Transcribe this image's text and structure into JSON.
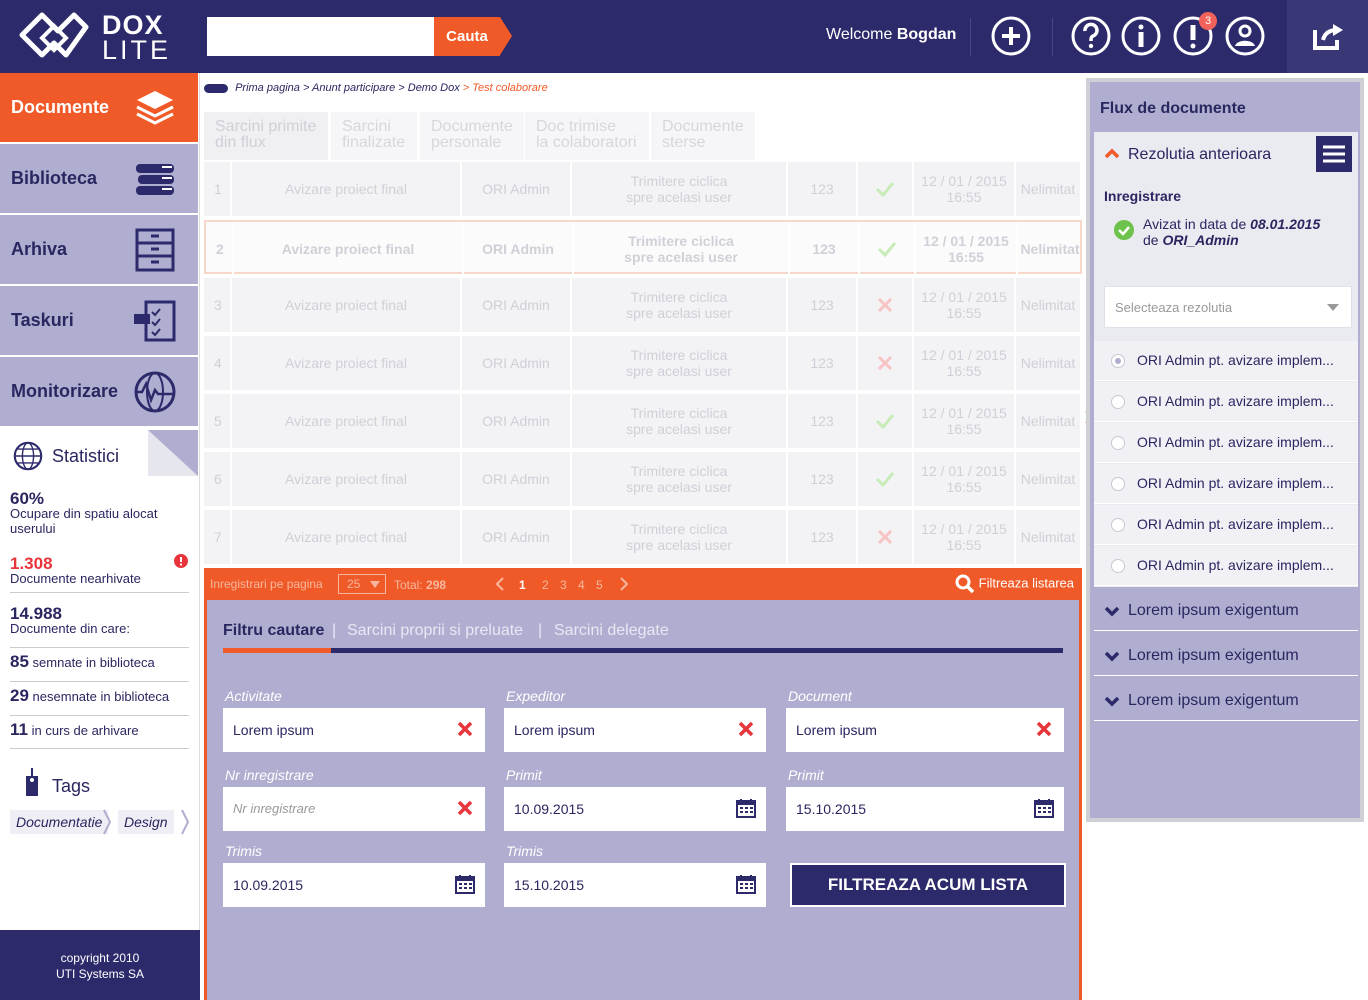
{
  "header": {
    "logo_top": "DOX",
    "logo_bottom": "LITE",
    "search_placeholder": "",
    "search_button": "Cauta",
    "welcome_prefix": "Welcome",
    "welcome_user": "Bogdan",
    "notifications_count": "3"
  },
  "sidebar": {
    "items": [
      {
        "label": "Documente",
        "icon": "stack-icon"
      },
      {
        "label": "Biblioteca",
        "icon": "books-icon"
      },
      {
        "label": "Arhiva",
        "icon": "cabinet-icon"
      },
      {
        "label": "Taskuri",
        "icon": "checklist-icon"
      },
      {
        "label": "Monitorizare",
        "icon": "globe-pulse-icon"
      }
    ],
    "stats_title": "Statistici",
    "stats": {
      "space_value": "60%",
      "space_label": "Ocupare din spatiu alocat userului",
      "unarchived_value": "1.308",
      "unarchived_label": "Documente nearhivate",
      "docs_value": "14.988",
      "docs_label": "Documente din care:",
      "signed_value": "85",
      "signed_label": "semnate in biblioteca",
      "unsigned_value": "29",
      "unsigned_label": "nesemnate in biblioteca",
      "archiving_value": "11",
      "archiving_label": "in curs de arhivare"
    },
    "tags_title": "Tags",
    "tags": [
      "Documentatie",
      "Design"
    ],
    "copyright_line1": "copyright 2010",
    "copyright_line2": "UTI Systems SA"
  },
  "breadcrumb": {
    "items": [
      "Prima pagina",
      "Anunt participare",
      "Demo Dox"
    ],
    "current": "Test colaborare"
  },
  "tabs": [
    {
      "line1": "Sarcini primite",
      "line2": "din flux"
    },
    {
      "line1": "Sarcini",
      "line2": "finalizate"
    },
    {
      "line1": "Documente",
      "line2": "personale"
    },
    {
      "line1": "Doc trimise",
      "line2": "la colaboratori"
    },
    {
      "line1": "Documente",
      "line2": "sterse"
    }
  ],
  "rows": [
    {
      "nr": "1",
      "title": "Avizare proiect final",
      "user": "ORI Admin",
      "type1": "Trimitere ciclica",
      "type2": "spre acelasi user",
      "code": "123",
      "status": "ok",
      "date": "12 / 01 / 2015",
      "time": "16:55",
      "term": "Nelimitat"
    },
    {
      "nr": "2",
      "title": "Avizare proiect final",
      "user": "ORI Admin",
      "type1": "Trimitere ciclica",
      "type2": "spre acelasi user",
      "code": "123",
      "status": "ok",
      "date": "12 / 01 / 2015",
      "time": "16:55",
      "term": "Nelimitat"
    },
    {
      "nr": "3",
      "title": "Avizare proiect final",
      "user": "ORI Admin",
      "type1": "Trimitere ciclica",
      "type2": "spre acelasi user",
      "code": "123",
      "status": "x",
      "date": "12 / 01 / 2015",
      "time": "16:55",
      "term": "Nelimitat"
    },
    {
      "nr": "4",
      "title": "Avizare proiect final",
      "user": "ORI Admin",
      "type1": "Trimitere ciclica",
      "type2": "spre acelasi user",
      "code": "123",
      "status": "x",
      "date": "12 / 01 / 2015",
      "time": "16:55",
      "term": "Nelimitat"
    },
    {
      "nr": "5",
      "title": "Avizare proiect final",
      "user": "ORI Admin",
      "type1": "Trimitere ciclica",
      "type2": "spre acelasi user",
      "code": "123",
      "status": "ok",
      "date": "12 / 01 / 2015",
      "time": "16:55",
      "term": "Nelimitat"
    },
    {
      "nr": "6",
      "title": "Avizare proiect final",
      "user": "ORI Admin",
      "type1": "Trimitere ciclica",
      "type2": "spre acelasi user",
      "code": "123",
      "status": "ok",
      "date": "12 / 01 / 2015",
      "time": "16:55",
      "term": "Nelimitat"
    },
    {
      "nr": "7",
      "title": "Avizare proiect final",
      "user": "ORI Admin",
      "type1": "Trimitere ciclica",
      "type2": "spre acelasi user",
      "code": "123",
      "status": "x",
      "date": "12 / 01 / 2015",
      "time": "16:55",
      "term": "Nelimitat"
    }
  ],
  "pager": {
    "per_page_label": "Inregistrari pe pagina",
    "per_page_value": "25",
    "total_label": "Total:",
    "total_value": "298",
    "pages": [
      "1",
      "2",
      "3",
      "4",
      "5"
    ],
    "filter_link": "Filtreaza listarea"
  },
  "filter": {
    "tabs": [
      "Filtru cautare",
      "Sarcini proprii si preluate",
      "Sarcini delegate"
    ],
    "activitate_label": "Activitate",
    "activitate_value": "Lorem ipsum",
    "expeditor_label": "Expeditor",
    "expeditor_value": "Lorem ipsum",
    "document_label": "Document",
    "document_value": "Lorem ipsum",
    "nr_label": "Nr inregistrare",
    "nr_placeholder": "Nr inregistrare",
    "primit_label": "Primit",
    "primit_from": "10.09.2015",
    "primit_to": "15.10.2015",
    "trimis_label": "Trimis",
    "trimis_from": "10.09.2015",
    "trimis_to": "15.10.2015",
    "submit": "FILTREAZA ACUM LISTA"
  },
  "right_panel": {
    "title": "Flux de documente",
    "section_title": "Rezolutia anterioara",
    "sub_title": "Inregistrare",
    "approved_text": "Avizat in data de",
    "approved_date": "08.01.2015",
    "approved_by_prefix": "de",
    "approved_by": "ORI_Admin",
    "select_placeholder": "Selecteaza rezolutia",
    "options": [
      "ORI Admin pt. avizare implem...",
      "ORI Admin pt. avizare implem...",
      "ORI Admin pt. avizare implem...",
      "ORI Admin pt. avizare implem...",
      "ORI Admin pt. avizare implem...",
      "ORI Admin pt. avizare implem..."
    ],
    "collapsed": [
      "Lorem ipsum exigentum",
      "Lorem ipsum exigentum",
      "Lorem ipsum exigentum"
    ]
  },
  "colors": {
    "primary": "#2d2a6b",
    "accent": "#f05a28",
    "lavender": "#b0aed0",
    "ok": "#6cc24a",
    "error": "#e8353b"
  }
}
